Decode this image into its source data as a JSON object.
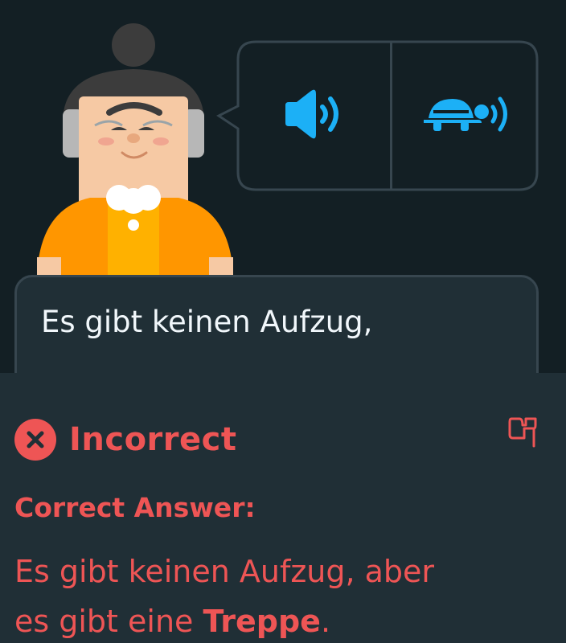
{
  "speaker": {
    "normal_audio_icon": "speaker-icon",
    "slow_audio_icon": "turtle-icon"
  },
  "answer": {
    "user_text": "Es gibt keinen Aufzug,"
  },
  "feedback": {
    "status_icon": "x-circle-icon",
    "status": "Incorrect",
    "report_icon": "flag-icon",
    "correct_label": "Correct Answer:",
    "correct_text_line1": "Es gibt keinen Aufzug, aber",
    "correct_text_line2_prefix": "es gibt eine ",
    "correct_text_highlight": "Treppe",
    "correct_text_suffix": "."
  },
  "colors": {
    "background": "#131f24",
    "panel": "#202f36",
    "border": "#37464f",
    "error": "#ee5555",
    "accent_blue": "#1cb0f6",
    "text": "#f1f7fb"
  }
}
